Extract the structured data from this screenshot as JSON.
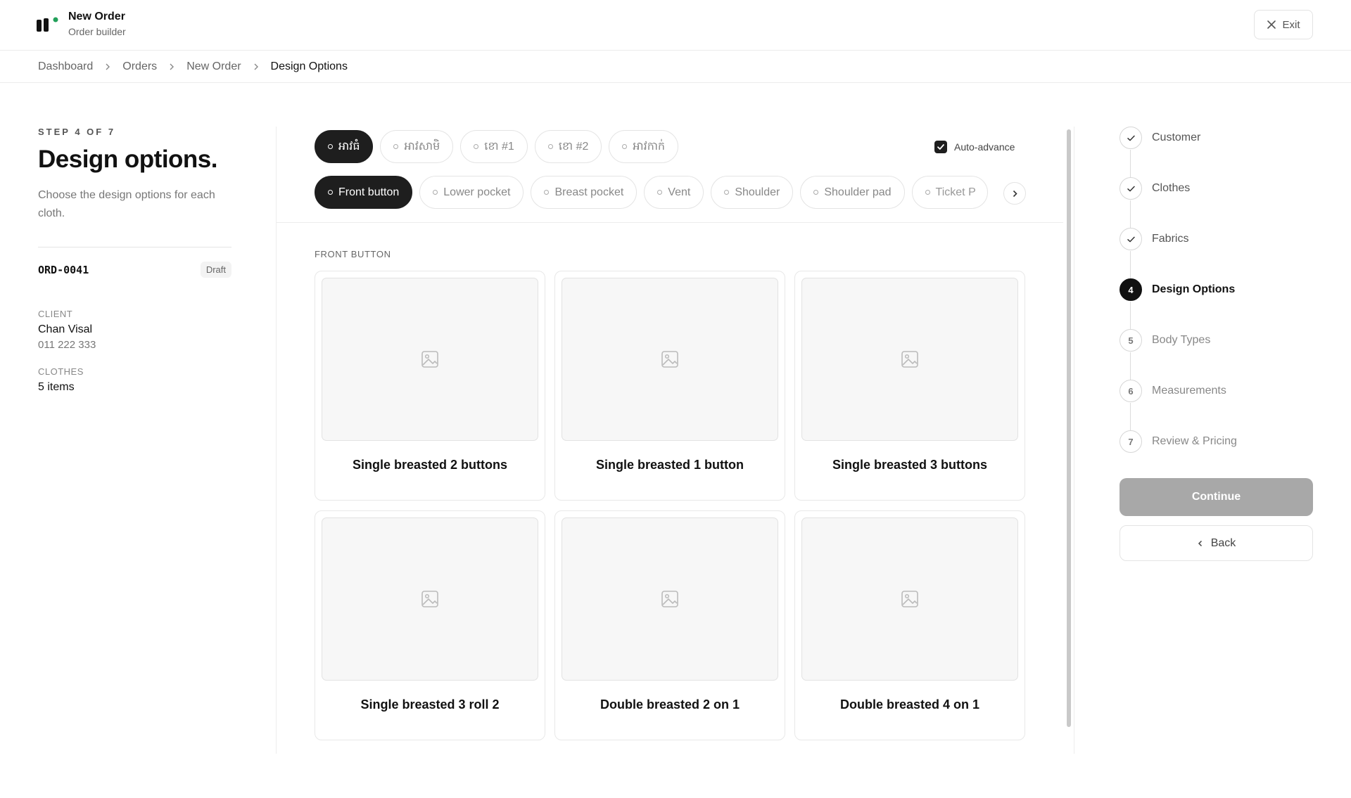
{
  "header": {
    "title": "New Order",
    "subtitle": "Order builder",
    "exit_label": "Exit",
    "brand_dot_color": "#22a05a"
  },
  "breadcrumb": [
    "Dashboard",
    "Orders",
    "New Order",
    "Design Options"
  ],
  "left": {
    "step_label": "STEP 4 OF 7",
    "title": "Design options.",
    "description": "Choose the design options for each cloth.",
    "order_id": "ORD-0041",
    "status": "Draft",
    "client_label": "CLIENT",
    "client_name": "Chan Visal",
    "client_phone": "011 222 333",
    "clothes_label": "CLOTHES",
    "clothes_count": "5 items"
  },
  "cloth_tabs": [
    {
      "label": "អាវធំ",
      "active": true
    },
    {
      "label": "អាវសាមិ",
      "active": false
    },
    {
      "label": "ខោ #1",
      "active": false
    },
    {
      "label": "ខោ #2",
      "active": false
    },
    {
      "label": "អាវកាក់",
      "active": false
    }
  ],
  "auto_advance": {
    "label": "Auto-advance",
    "checked": true
  },
  "option_tabs": [
    {
      "label": "Front button",
      "active": true
    },
    {
      "label": "Lower pocket",
      "active": false
    },
    {
      "label": "Breast pocket",
      "active": false
    },
    {
      "label": "Vent",
      "active": false
    },
    {
      "label": "Shoulder",
      "active": false
    },
    {
      "label": "Shoulder pad",
      "active": false
    },
    {
      "label": "Ticket P",
      "active": false
    }
  ],
  "section_title": "FRONT BUTTON",
  "options": [
    "Single breasted 2 buttons",
    "Single breasted 1 button",
    "Single breasted 3 buttons",
    "Single breasted 3 roll 2",
    "Double breasted 2 on 1",
    "Double breasted 4 on 1"
  ],
  "steps": [
    {
      "number": "1",
      "label": "Customer",
      "state": "done"
    },
    {
      "number": "2",
      "label": "Clothes",
      "state": "done"
    },
    {
      "number": "3",
      "label": "Fabrics",
      "state": "done"
    },
    {
      "number": "4",
      "label": "Design Options",
      "state": "current"
    },
    {
      "number": "5",
      "label": "Body Types",
      "state": "upcoming"
    },
    {
      "number": "6",
      "label": "Measurements",
      "state": "upcoming"
    },
    {
      "number": "7",
      "label": "Review & Pricing",
      "state": "upcoming"
    }
  ],
  "actions": {
    "continue_label": "Continue",
    "back_label": "Back"
  }
}
